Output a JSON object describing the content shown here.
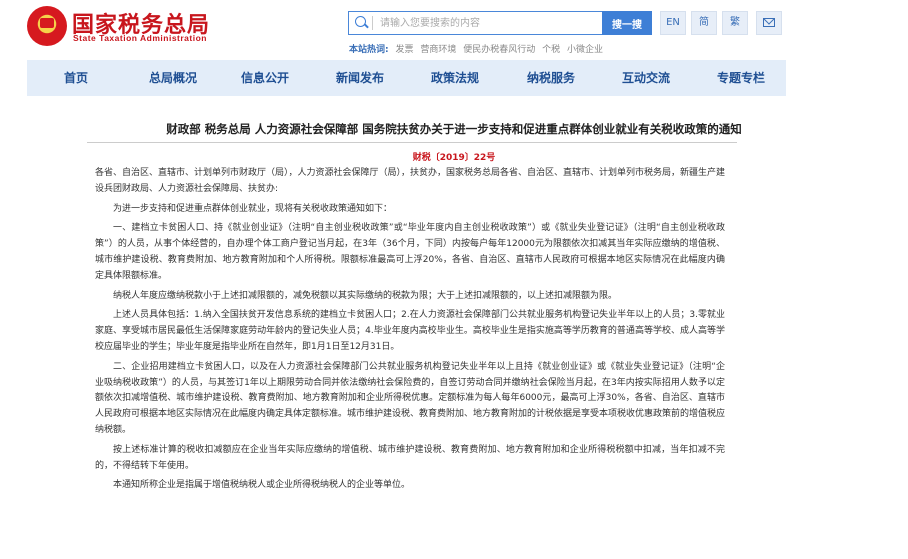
{
  "header": {
    "site_name": "国家税务总局",
    "site_name_en": "State Taxation Administration",
    "search_placeholder": "请输入您要搜索的内容",
    "search_button": "搜一搜",
    "hot_label": "本站热词:",
    "hot_words": [
      "发票",
      "营商环境",
      "便民办税春风行动",
      "个税",
      "小微企业"
    ],
    "lang_en": "EN",
    "lang_simplified": "简",
    "lang_traditional": "繁"
  },
  "nav": {
    "items": [
      "首页",
      "总局概况",
      "信息公开",
      "新闻发布",
      "政策法规",
      "纳税服务",
      "互动交流",
      "专题专栏"
    ]
  },
  "article": {
    "title": "财政部 税务总局 人力资源社会保障部 国务院扶贫办关于进一步支持和促进重点群体创业就业有关税收政策的通知",
    "doc_number": "财税〔2019〕22号",
    "paragraphs": [
      "各省、自治区、直辖市、计划单列市财政厅（局），人力资源社会保障厅（局），扶贫办，国家税务总局各省、自治区、直辖市、计划单列市税务局，新疆生产建设兵团财政局、人力资源社会保障局、扶贫办:",
      "为进一步支持和促进重点群体创业就业，现将有关税收政策通知如下：",
      "一、建档立卡贫困人口、持《就业创业证》（注明“自主创业税收政策”或“毕业年度内自主创业税收政策”）或《就业失业登记证》（注明“自主创业税收政策”）的人员，从事个体经营的，自办理个体工商户登记当月起，在3年（36个月，下同）内按每户每年12000元为限额依次扣减其当年实际应缴纳的增值税、城市维护建设税、教育费附加、地方教育附加和个人所得税。限额标准最高可上浮20%，各省、自治区、直辖市人民政府可根据本地区实际情况在此幅度内确定具体限额标准。",
      "纳税人年度应缴纳税款小于上述扣减限额的，减免税额以其实际缴纳的税款为限；大于上述扣减限额的，以上述扣减限额为限。",
      "上述人员具体包括：1.纳入全国扶贫开发信息系统的建档立卡贫困人口；2.在人力资源社会保障部门公共就业服务机构登记失业半年以上的人员；3.零就业家庭、享受城市居民最低生活保障家庭劳动年龄内的登记失业人员；4.毕业年度内高校毕业生。高校毕业生是指实施高等学历教育的普通高等学校、成人高等学校应届毕业的学生；毕业年度是指毕业所在自然年，即1月1日至12月31日。",
      "二、企业招用建档立卡贫困人口，以及在人力资源社会保障部门公共就业服务机构登记失业半年以上且持《就业创业证》或《就业失业登记证》（注明“企业吸纳税收政策”）的人员，与其签订1年以上期限劳动合同并依法缴纳社会保险费的，自签订劳动合同并缴纳社会保险当月起，在3年内按实际招用人数予以定额依次扣减增值税、城市维护建设税、教育费附加、地方教育附加和企业所得税优惠。定额标准为每人每年6000元，最高可上浮30%，各省、自治区、直辖市人民政府可根据本地区实际情况在此幅度内确定具体定额标准。城市维护建设税、教育费附加、地方教育附加的计税依据是享受本项税收优惠政策前的增值税应纳税额。",
      "按上述标准计算的税收扣减额应在企业当年实际应缴纳的增值税、城市维护建设税、教育费附加、地方教育附加和企业所得税税额中扣减，当年扣减不完的，不得结转下年使用。",
      "本通知所称企业是指属于增值税纳税人或企业所得税纳税人的企业等单位。"
    ]
  }
}
